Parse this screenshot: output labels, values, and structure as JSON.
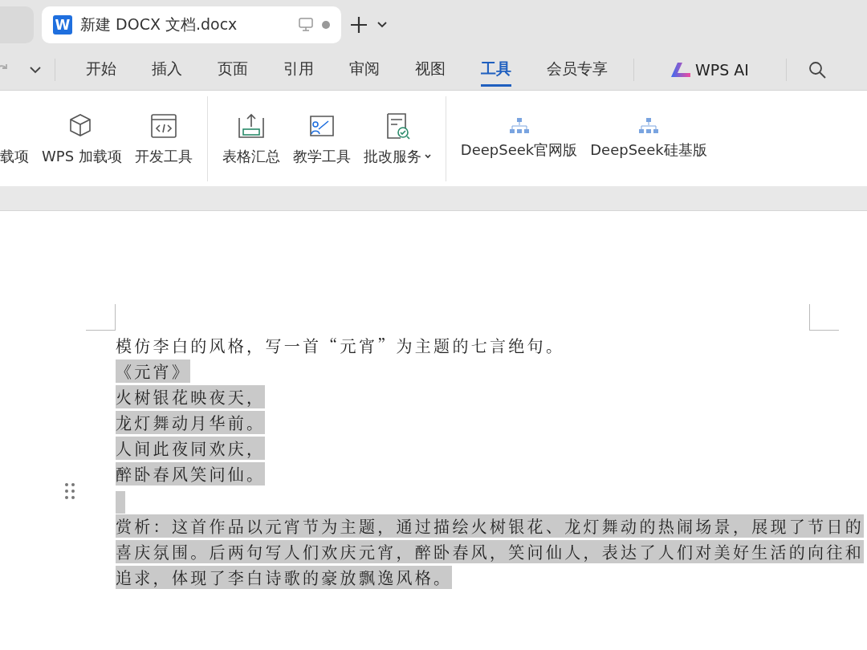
{
  "tab_bar": {
    "active_tab": {
      "title": "新建 DOCX 文档.docx",
      "app_letter": "W"
    }
  },
  "menu": {
    "tabs": [
      {
        "label": "开始",
        "selected": false
      },
      {
        "label": "插入",
        "selected": false
      },
      {
        "label": "页面",
        "selected": false
      },
      {
        "label": "引用",
        "selected": false
      },
      {
        "label": "审阅",
        "selected": false
      },
      {
        "label": "视图",
        "selected": false
      },
      {
        "label": "工具",
        "selected": true
      },
      {
        "label": "会员专享",
        "selected": false
      }
    ],
    "ai_button": "WPS AI"
  },
  "ribbon": {
    "groups": [
      [
        {
          "label": "载项",
          "kind": "cut"
        },
        {
          "label": "WPS 加载项",
          "kind": "cube"
        },
        {
          "label": "开发工具",
          "kind": "code"
        }
      ],
      [
        {
          "label": "表格汇总",
          "kind": "table"
        },
        {
          "label": "教学工具",
          "kind": "teach"
        },
        {
          "label": "批改服务",
          "kind": "review",
          "dropdown": true
        }
      ],
      [
        {
          "label": "DeepSeek官网版",
          "kind": "deepseek"
        },
        {
          "label": "DeepSeek硅基版",
          "kind": "deepseek"
        }
      ]
    ]
  },
  "document": {
    "paragraphs": [
      {
        "text": "模仿李白的风格，写一首“元宵”为主题的七言绝句。",
        "selected": false
      },
      {
        "text": "《元宵》",
        "selected": true
      },
      {
        "text": "火树银花映夜天，",
        "selected": true
      },
      {
        "text": "龙灯舞动月华前。",
        "selected": true
      },
      {
        "text": "人间此夜同欢庆，",
        "selected": true
      },
      {
        "text": "醉卧春风笑问仙。",
        "selected": true
      },
      {
        "kind": "blank",
        "selected": true
      },
      {
        "text": "赏析：这首作品以元宵节为主题，通过描绘火树银花、龙灯舞动的热闹场景，展现了节日的",
        "selected": true
      },
      {
        "text": "喜庆氛围。后两句写人们欢庆元宵，醉卧春风，笑问仙人，表达了人们对美好生活的向往和",
        "selected": true
      },
      {
        "text": "追求，体现了李白诗歌的豪放飘逸风格。",
        "selected": true
      }
    ]
  }
}
